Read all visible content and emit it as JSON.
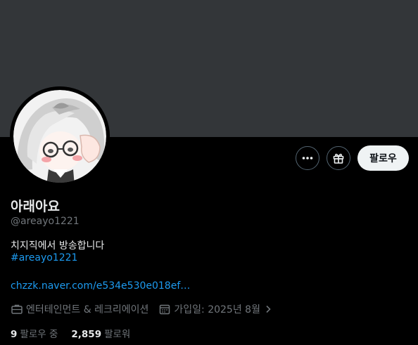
{
  "profile": {
    "display_name": "아래아요",
    "handle": "@areayo1221",
    "bio": "치지직에서 방송합니다",
    "hashtag": "#areayo1221",
    "link": "chzzk.naver.com/e534e530e018ef…",
    "category": "엔터테인먼트 & 레크리에이션",
    "joined": "가입일: 2025년 8월"
  },
  "actions": {
    "more_icon": "more-dots-icon",
    "subscribe_icon": "gift-icon",
    "follow_label": "팔로우"
  },
  "stats": {
    "following_count": "9",
    "following_label": "팔로우 중",
    "followers_count": "2,859",
    "followers_label": "팔로워"
  },
  "colors": {
    "background": "#000000",
    "banner": "#333639",
    "accent": "#1d9bf0",
    "muted": "#71767b"
  }
}
